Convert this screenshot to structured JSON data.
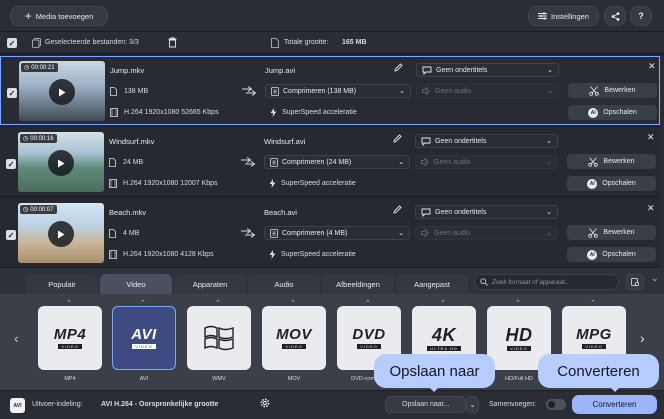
{
  "topbar": {
    "add_media_label": "Media toevoegen",
    "settings_label": "Instellingen"
  },
  "selection": {
    "selected_label": "Geselecteerde bestanden: 3/3",
    "total_size_label": "Totale grootte:",
    "total_size_value": "165 MB"
  },
  "files": [
    {
      "duration": "00:00:21",
      "source_name": "Jump.mkv",
      "size": "138 MB",
      "codec": "H.264 1920x1080 52665 Kbps",
      "output_name": "Jump.avi",
      "compress": "Comprimeren (138 MB)",
      "accel": "SuperSpeed acceleratie",
      "subtitles": "Geen ondertitels",
      "audio": "Geen audio",
      "edit_label": "Bewerken",
      "scale_label": "Opschalen"
    },
    {
      "duration": "00:00:16",
      "source_name": "Windsurf.mkv",
      "size": "24 MB",
      "codec": "H.264 1920x1080 12007 Kbps",
      "output_name": "Windsurf.avi",
      "compress": "Comprimeren (24 MB)",
      "accel": "SuperSpeed acceleratie",
      "subtitles": "Geen ondertitels",
      "audio": "Geen audio",
      "edit_label": "Bewerken",
      "scale_label": "Opschalen"
    },
    {
      "duration": "00:00:07",
      "source_name": "Beach.mkv",
      "size": "4 MB",
      "codec": "H.264 1920x1080 4128 Kbps",
      "output_name": "Beach.avi",
      "compress": "Comprimeren (4 MB)",
      "accel": "SuperSpeed acceleratie",
      "subtitles": "Geen ondertitels",
      "audio": "Geen audio",
      "edit_label": "Bewerken",
      "scale_label": "Opschalen"
    }
  ],
  "tabs": [
    "Populair",
    "Video",
    "Apparaten",
    "Audio",
    "Afbeeldingen",
    "Aangepast"
  ],
  "search_placeholder": "Zoek formaat of apparaat...",
  "formats": [
    {
      "badge": "MP4",
      "sub": "VIDEO",
      "label": "MP4"
    },
    {
      "badge": "AVI",
      "sub": "VIDEO",
      "label": "AVI"
    },
    {
      "badge": "",
      "sub": "",
      "label": "WMV"
    },
    {
      "badge": "MOV",
      "sub": "VIDEO",
      "label": "MOV"
    },
    {
      "badge": "DVD",
      "sub": "VIDEO",
      "label": "DVD-compatib"
    },
    {
      "badge": "4K",
      "sub": "ULTRA HD",
      "label": "4K Ultra HD"
    },
    {
      "badge": "HD",
      "sub": "VIDEO",
      "label": "HD/Full HD"
    },
    {
      "badge": "MPG",
      "sub": "VIDEO",
      "label": "MPG"
    }
  ],
  "bottom": {
    "output_label": "Uitvoer-indeling:",
    "output_value": "AVI H.264 - Oorspronkelijke grootte",
    "save_label": "Opslaan naar...",
    "merge_label": "Samenvoegen:",
    "convert_label": "Converteren"
  },
  "tooltips": {
    "save": "Opslaan naar",
    "convert": "Converteren"
  },
  "colors": {
    "accent": "#9bb5ff",
    "selection_border": "#7ea6ff",
    "background": "#23262d"
  }
}
